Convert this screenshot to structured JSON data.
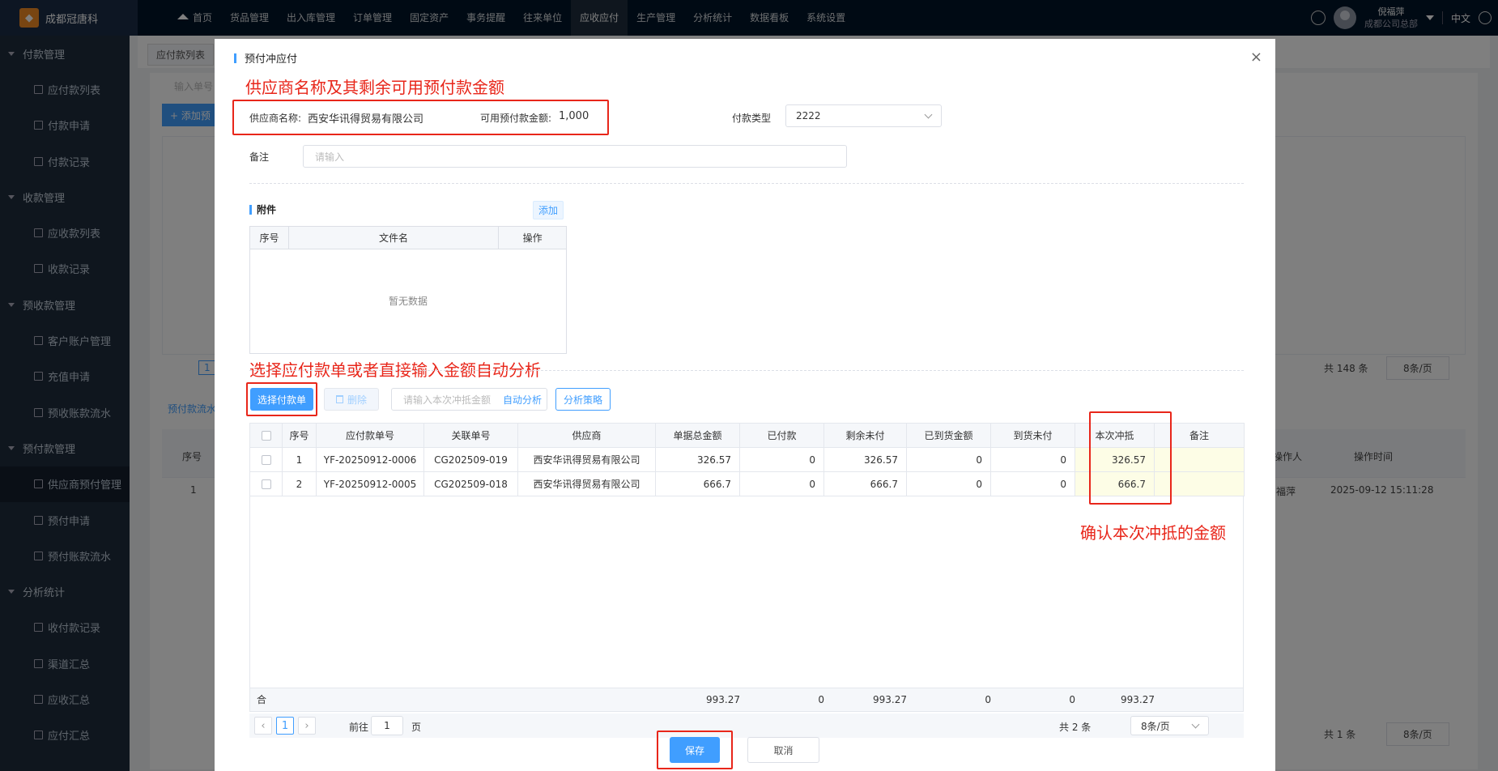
{
  "topbar": {
    "logo_text": "成都冠唐科",
    "nav": [
      "首页",
      "货品管理",
      "出入库管理",
      "订单管理",
      "固定资产",
      "事务提醒",
      "往来单位",
      "应收应付",
      "生产管理",
      "分析统计",
      "数据看板",
      "系统设置"
    ],
    "active_nav": "应收应付",
    "user_name": "倪福萍",
    "user_org": "成都公司总部",
    "lang": "中文"
  },
  "sidebar": {
    "entries": [
      {
        "type": "group",
        "label": "付款管理"
      },
      {
        "type": "item",
        "label": "应付款列表"
      },
      {
        "type": "item",
        "label": "付款申请"
      },
      {
        "type": "item",
        "label": "付款记录"
      },
      {
        "type": "group",
        "label": "收款管理"
      },
      {
        "type": "item",
        "label": "应收款列表"
      },
      {
        "type": "item",
        "label": "收款记录"
      },
      {
        "type": "group",
        "label": "预收款管理"
      },
      {
        "type": "item",
        "label": "客户账户管理"
      },
      {
        "type": "item",
        "label": "充值申请"
      },
      {
        "type": "item",
        "label": "预收账款流水"
      },
      {
        "type": "group",
        "label": "预付款管理"
      },
      {
        "type": "item",
        "label": "供应商预付管理"
      },
      {
        "type": "item",
        "label": "预付申请"
      },
      {
        "type": "item",
        "label": "预付账款流水"
      },
      {
        "type": "group",
        "label": "分析统计"
      },
      {
        "type": "item",
        "label": "收付款记录"
      },
      {
        "type": "item",
        "label": "渠道汇总"
      },
      {
        "type": "item",
        "label": "应收汇总"
      },
      {
        "type": "item",
        "label": "应付汇总"
      }
    ],
    "active_item": "供应商预付管理"
  },
  "background": {
    "tab": "应付款列表",
    "search_placeholder": "输入单号",
    "add_button": "+ 添加预",
    "page_num": "1",
    "total_top": "共 148 条",
    "page_size_top": "8条/页",
    "lower_tab": "预付款流水",
    "lower_col_seq": "序号",
    "lower_col_operator": "操作人",
    "lower_col_time": "操作时间",
    "lower_row_seq": "1",
    "lower_row_operator": "福萍",
    "lower_row_time": "2025-09-12 15:11:28",
    "total_bottom": "共 1 条",
    "page_size_bottom": "8条/页"
  },
  "dialog": {
    "title": "预付冲应付",
    "close": "×",
    "annotations": {
      "supplier": "供应商名称及其剩余可用预付款金额",
      "select": "选择应付款单或者直接输入金额自动分析",
      "confirm": "确认本次冲抵的金额"
    },
    "supplier_label": "供应商名称:",
    "supplier_value": "西安华讯得贸易有限公司",
    "available_label": "可用预付款金额:",
    "available_value": "1,000",
    "pay_type_label": "付款类型",
    "pay_type_value": "2222",
    "remark_label": "备注",
    "remark_placeholder": "请输入",
    "attachment_title": "附件",
    "attachment_add": "添加",
    "attachment_columns": [
      "序号",
      "文件名",
      "操作"
    ],
    "attachment_empty": "暂无数据",
    "select_button": "选择付款单",
    "delete_button": "删除",
    "amount_placeholder": "请输入本次冲抵金额",
    "auto_analyze": "自动分析",
    "strategy_button": "分析策略",
    "columns": [
      "序号",
      "应付款单号",
      "关联单号",
      "供应商",
      "单据总金额",
      "已付款",
      "剩余未付",
      "已到货金额",
      "到货未付",
      "本次冲抵",
      "备注"
    ],
    "rows": [
      {
        "seq": "1",
        "bill_no": "YF-20250912-0006",
        "ref_no": "CG202509-019",
        "supplier": "西安华讯得贸易有限公司",
        "total": "326.57",
        "paid": "0",
        "remaining": "326.57",
        "arrived": "0",
        "arrived_unpaid": "0",
        "offset": "326.57",
        "remark": ""
      },
      {
        "seq": "2",
        "bill_no": "YF-20250912-0005",
        "ref_no": "CG202509-018",
        "supplier": "西安华讯得贸易有限公司",
        "total": "666.7",
        "paid": "0",
        "remaining": "666.7",
        "arrived": "0",
        "arrived_unpaid": "0",
        "offset": "666.7",
        "remark": ""
      }
    ],
    "summary": {
      "label": "合计",
      "total": "993.27",
      "paid": "0",
      "remaining": "993.27",
      "arrived": "0",
      "arrived_unpaid": "0",
      "offset": "993.27"
    },
    "pager": {
      "current": "1",
      "goto_prefix": "前往",
      "goto_value": "1",
      "goto_suffix": "页",
      "total": "共 2 条",
      "page_size": "8条/页"
    },
    "save_button": "保存",
    "cancel_button": "取消"
  },
  "colors": {
    "primary": "#409eff",
    "annotation": "#e8261a",
    "sidebar_bg": "#1f2d3d",
    "topbar_bg": "#001529"
  }
}
